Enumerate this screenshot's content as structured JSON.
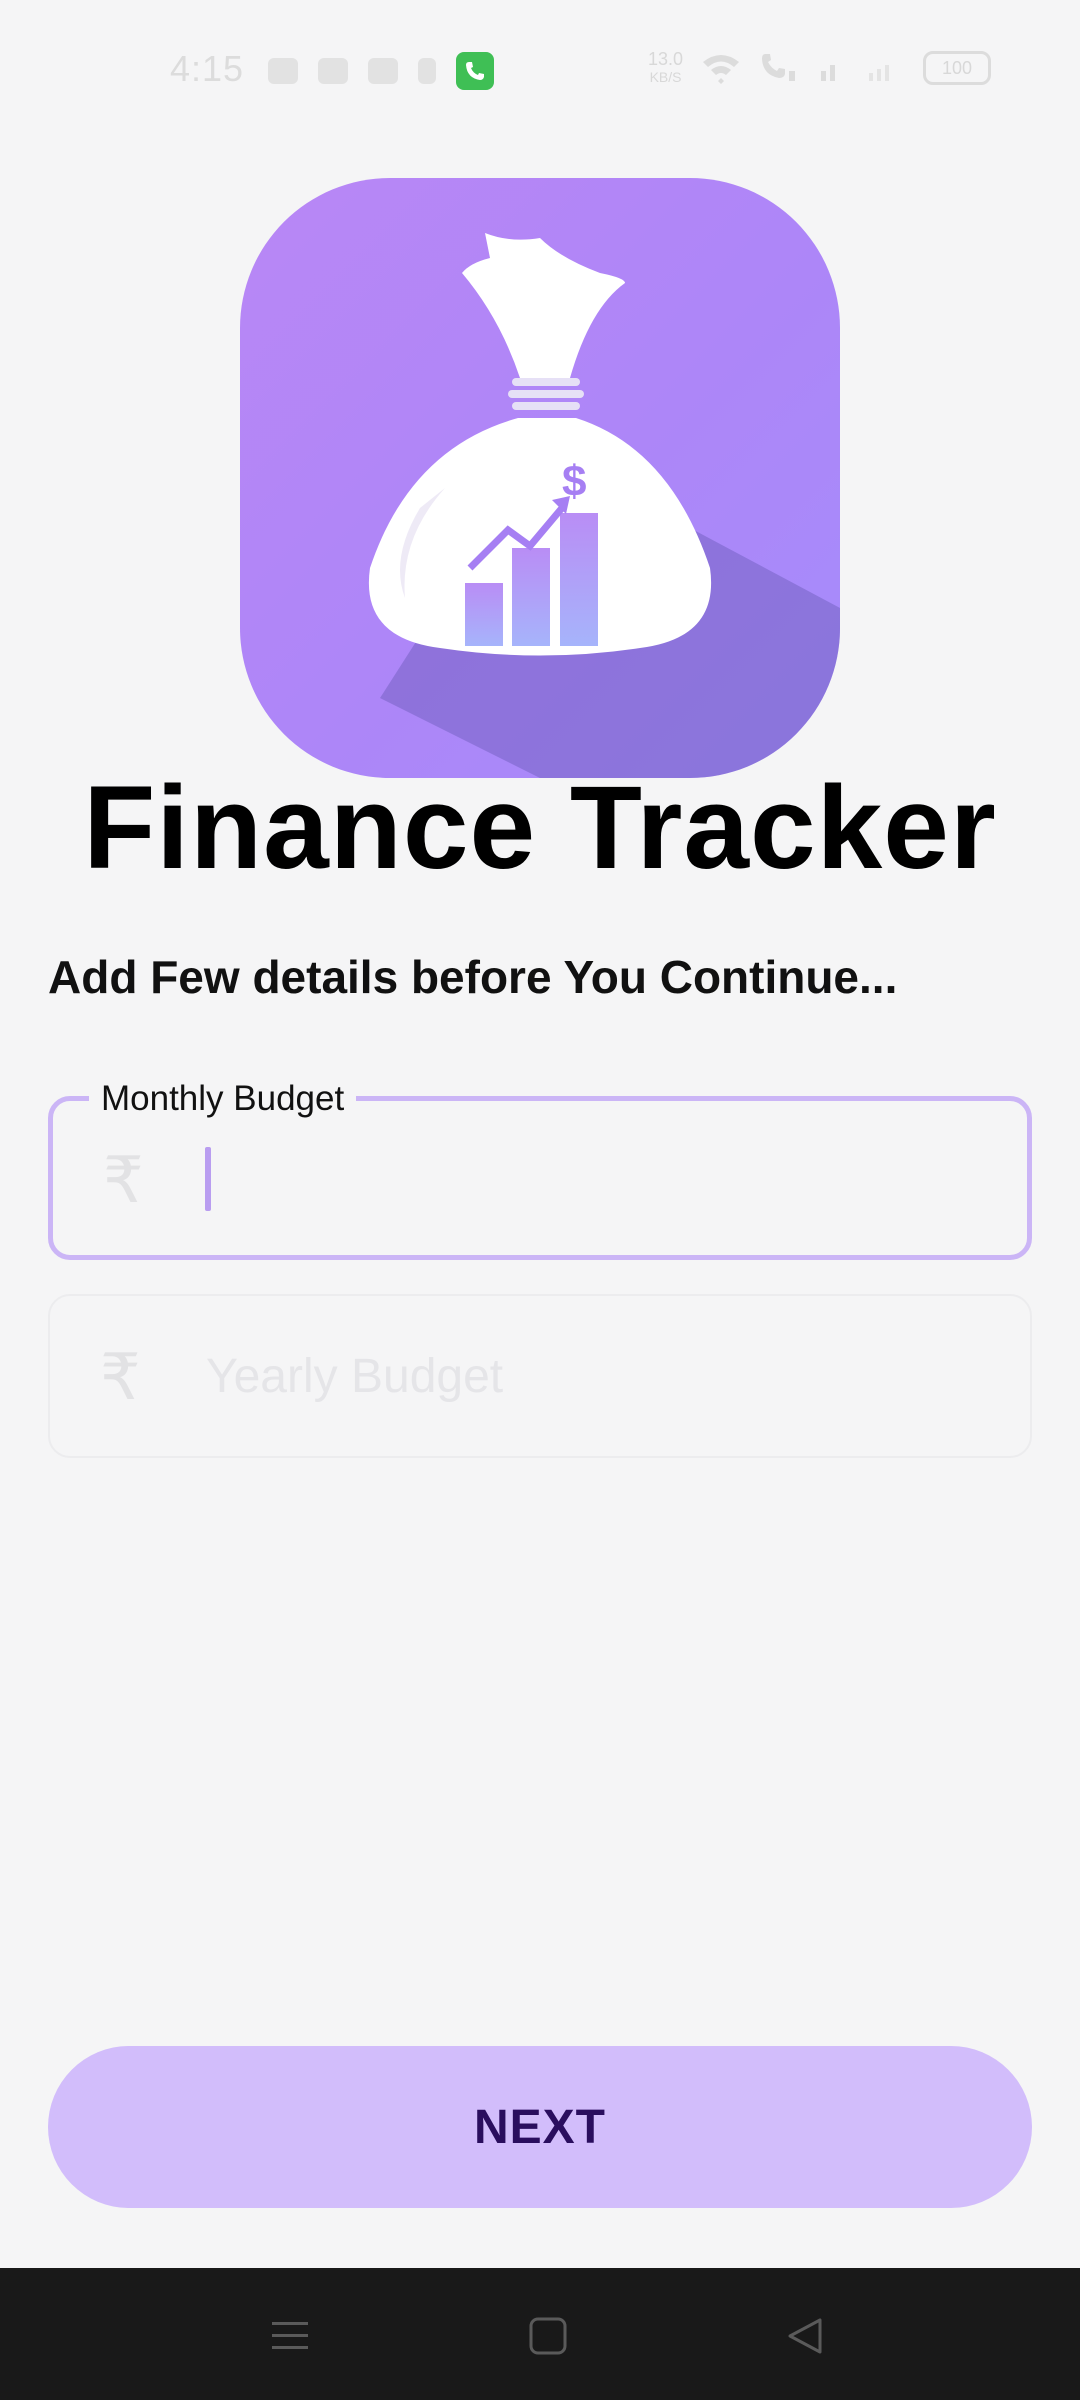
{
  "status_bar": {
    "time": "4:15",
    "net_speed_value": "13.0",
    "net_speed_unit": "KB/S",
    "battery": "100",
    "call_color": "#3fbf55"
  },
  "app": {
    "title": "Finance Tracker",
    "logo_icon": "money-bag-growth-icon",
    "accent_color": "#b987f5"
  },
  "form": {
    "instructions": "Add Few details before You Continue...",
    "monthly_budget": {
      "label": "Monthly Budget",
      "value": "",
      "currency_symbol": "₹"
    },
    "yearly_budget": {
      "placeholder": "Yearly Budget",
      "value": "",
      "currency_symbol": "₹"
    }
  },
  "next_button": {
    "label": "NEXT",
    "color": "#d2bdfb"
  },
  "nav_bar": {
    "icons": [
      "menu-icon",
      "home-square-icon",
      "back-triangle-icon"
    ]
  }
}
